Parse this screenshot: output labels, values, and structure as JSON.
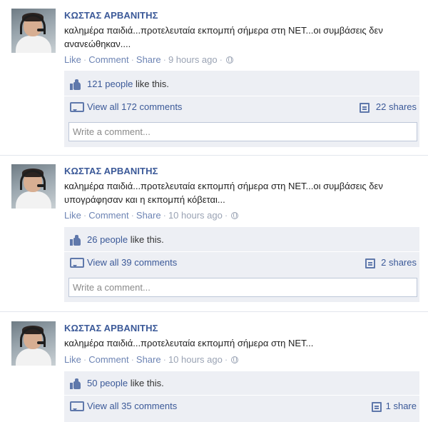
{
  "posts": [
    {
      "author": "ΚΩΣΤΑΣ ΑΡΒΑΝΙΤΗΣ",
      "message": "καλημέρα παιδιά...προτελευταία εκπομπή σήμερα στη ΝΕΤ...οι συμβάσεις δεν ανανεώθηκαν....",
      "like_label": "Like",
      "comment_label": "Comment",
      "share_label": "Share",
      "time": "9 hours ago",
      "likes_link": "121 people",
      "likes_suffix": " like this.",
      "view_comments": "View all 172 comments",
      "shares": "22 shares",
      "comment_placeholder": "Write a comment..."
    },
    {
      "author": "ΚΩΣΤΑΣ ΑΡΒΑΝΙΤΗΣ",
      "message": "καλημέρα παιδιά...προτελευταία εκπομπή σήμερα στη ΝΕΤ...οι συμβάσεις δεν υπογράφησαν και η εκπομπή κόβεται...",
      "like_label": "Like",
      "comment_label": "Comment",
      "share_label": "Share",
      "time": "10 hours ago",
      "likes_link": "26 people",
      "likes_suffix": " like this.",
      "view_comments": "View all 39 comments",
      "shares": "2 shares",
      "comment_placeholder": "Write a comment..."
    },
    {
      "author": "ΚΩΣΤΑΣ ΑΡΒΑΝΙΤΗΣ",
      "message": "καλημέρα παιδιά...προτελευταία εκπομπή σήμερα στη ΝΕΤ...",
      "like_label": "Like",
      "comment_label": "Comment",
      "share_label": "Share",
      "time": "10 hours ago",
      "likes_link": "50 people",
      "likes_suffix": " like this.",
      "view_comments": "View all 35 comments",
      "shares": "1 share"
    }
  ],
  "icons": {
    "like": "thumbs-up-icon",
    "comments": "speech-bubble-icon",
    "shares": "share-doc-icon",
    "privacy": "globe-icon"
  },
  "colors": {
    "link": "#3b5998",
    "ufi_background": "#edeff4",
    "muted": "#9aa3b4"
  }
}
